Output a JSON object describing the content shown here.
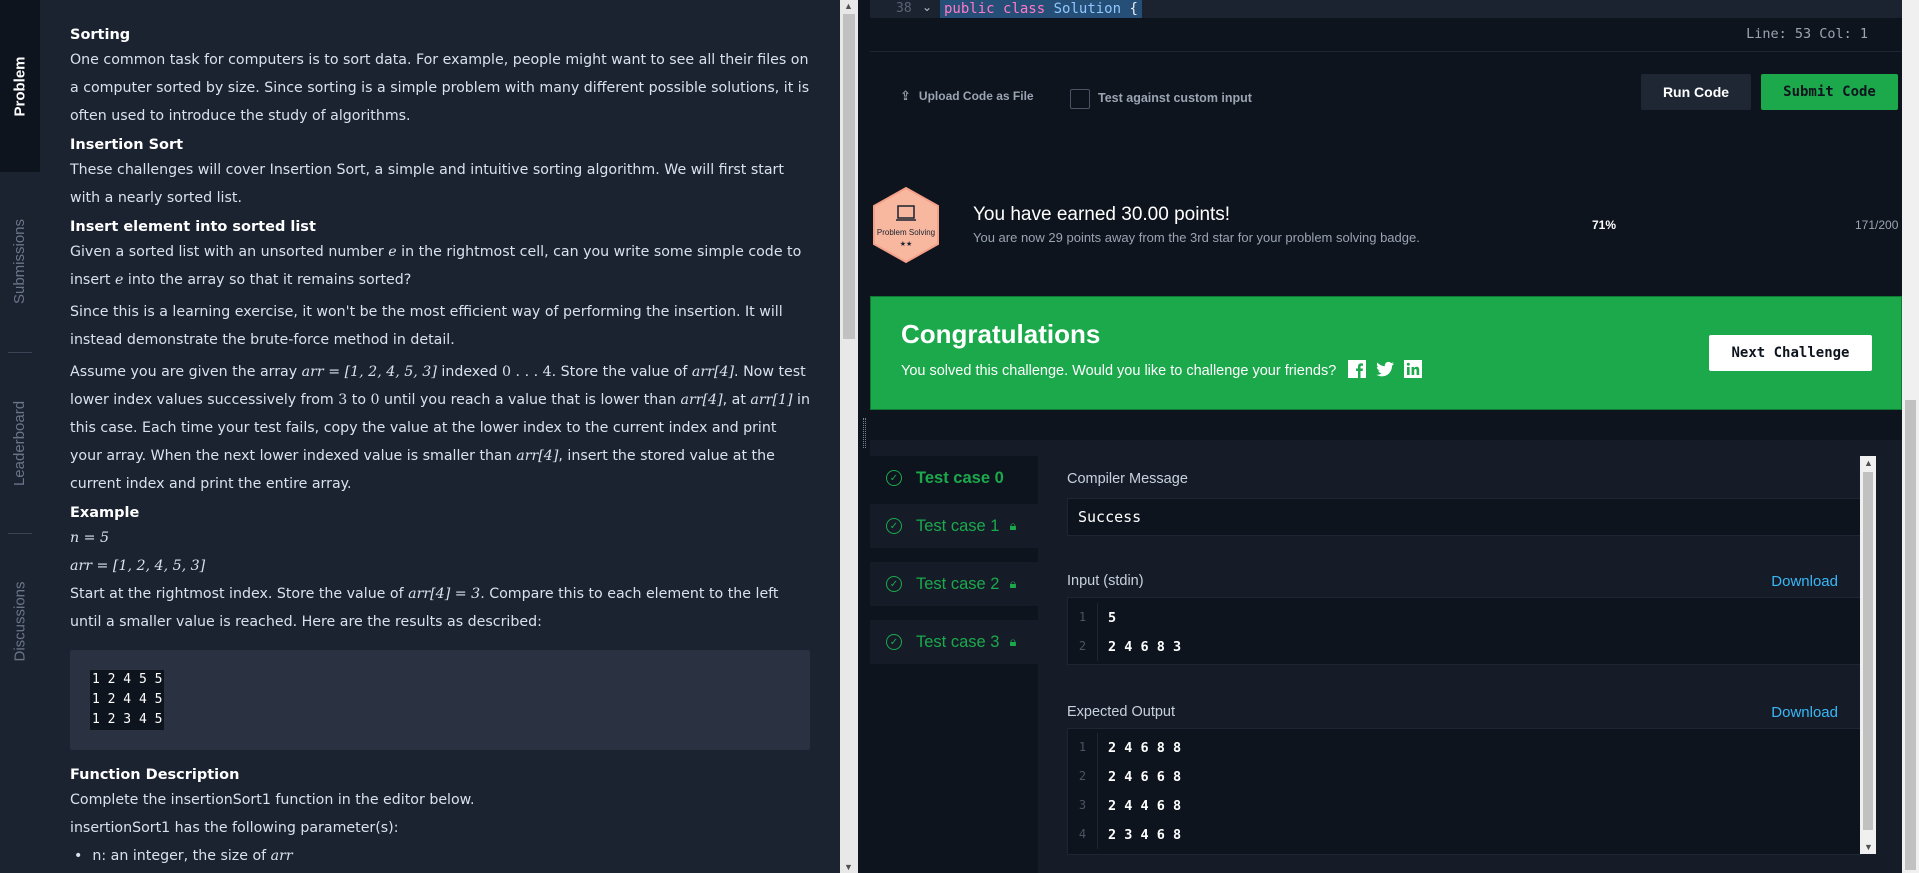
{
  "side_tabs": [
    "Problem",
    "Submissions",
    "Leaderboard",
    "Discussions"
  ],
  "problem": {
    "h_sorting": "Sorting",
    "p_sorting": "One common task for computers is to sort data. For example, people might want to see all their files on a computer sorted by size. Since sorting is a simple problem with many different possible solutions, it is often used to introduce the study of algorithms.",
    "h_insertion": "Insertion Sort",
    "p_insertion": "These challenges will cover Insertion Sort, a simple and intuitive sorting algorithm. We will first start with a nearly sorted list.",
    "h_insert_el": "Insert element into sorted list",
    "p_insert_a": "Given a sorted list with an unsorted number ",
    "p_insert_e1": "e",
    "p_insert_b": " in the rightmost cell, can you write some simple code to insert ",
    "p_insert_e2": "e",
    "p_insert_c": " into the array so that it remains sorted?",
    "p_learning": "Since this is a learning exercise, it won't be the most efficient way of performing the insertion. It will instead demonstrate the brute-force method in detail.",
    "assume": {
      "t1": "Assume you are given the array ",
      "m1": "arr = [1, 2, 4, 5, 3]",
      "t2": " indexed ",
      "m2": "0 . . . 4",
      "t3": ". Store the value of ",
      "m3": "arr[4]",
      "t4": ". Now test lower index values successively from ",
      "m4": "3",
      "t5": " to ",
      "m5": "0",
      "t6": " until you reach a value that is lower than ",
      "m6": "arr[4]",
      "t7": ", at ",
      "m7": "arr[1]",
      "t8": " in this case. Each time your test fails, copy the value at the lower index to the current index and print your array. When the next lower indexed value is smaller than ",
      "m8": "arr[4]",
      "t9": ", insert the stored value at the current index and print the entire array."
    },
    "h_example": "Example",
    "ex_n": "n = 5",
    "ex_arr": "arr = [1, 2, 4, 5, 3]",
    "start": {
      "t1": "Start at the rightmost index. Store the value of ",
      "m1": "arr[4] = 3",
      "t2": ". Compare this to each element to the left until a smaller value is reached. Here are the results as described:"
    },
    "code_lines": [
      "1 2 4 5 5",
      "1 2 4 4 5",
      "1 2 3 4 5"
    ],
    "h_func": "Function Description",
    "p_func": "Complete the insertionSort1 function in the editor below.",
    "p_params": "insertionSort1 has the following parameter(s):",
    "param_a": "n: an integer, the size of ",
    "param_m": "arr"
  },
  "editor": {
    "line_number": "38",
    "kw1": "public",
    "kw2": "class",
    "cls": "Solution",
    "brace": "{",
    "status": "Line: 53  Col: 1"
  },
  "actions": {
    "upload": "Upload Code as File",
    "custom_input": "Test against custom input",
    "run": "Run Code",
    "submit": "Submit Code"
  },
  "badge": {
    "name": "Problem Solving",
    "stars": "★★",
    "earned": "You have earned 30.00 points!",
    "sub": "You are now 29 points away from the 3rd star for your problem solving badge.",
    "percent": "71%",
    "progress": "171/200"
  },
  "congrats": {
    "title": "Congratulations",
    "message": "You solved this challenge. Would you like to challenge your friends?",
    "next": "Next Challenge"
  },
  "testcases": [
    {
      "label": "Test case 0",
      "locked": false
    },
    {
      "label": "Test case 1",
      "locked": true
    },
    {
      "label": "Test case 2",
      "locked": true
    },
    {
      "label": "Test case 3",
      "locked": true
    }
  ],
  "result": {
    "compiler_label": "Compiler Message",
    "compiler_value": "Success",
    "input_label": "Input (stdin)",
    "download": "Download",
    "input_lines": [
      "5",
      "2 4 6 8 3"
    ],
    "expected_label": "Expected Output",
    "expected_lines": [
      "2 4 6 8 8",
      "2 4 6 6 8",
      "2 4 4 6 8",
      "2 3 4 6 8"
    ]
  },
  "colors": {
    "accent": "#1ba94c",
    "link": "#39b7f6",
    "bg": "#0e141e",
    "panel": "#1b2230"
  }
}
